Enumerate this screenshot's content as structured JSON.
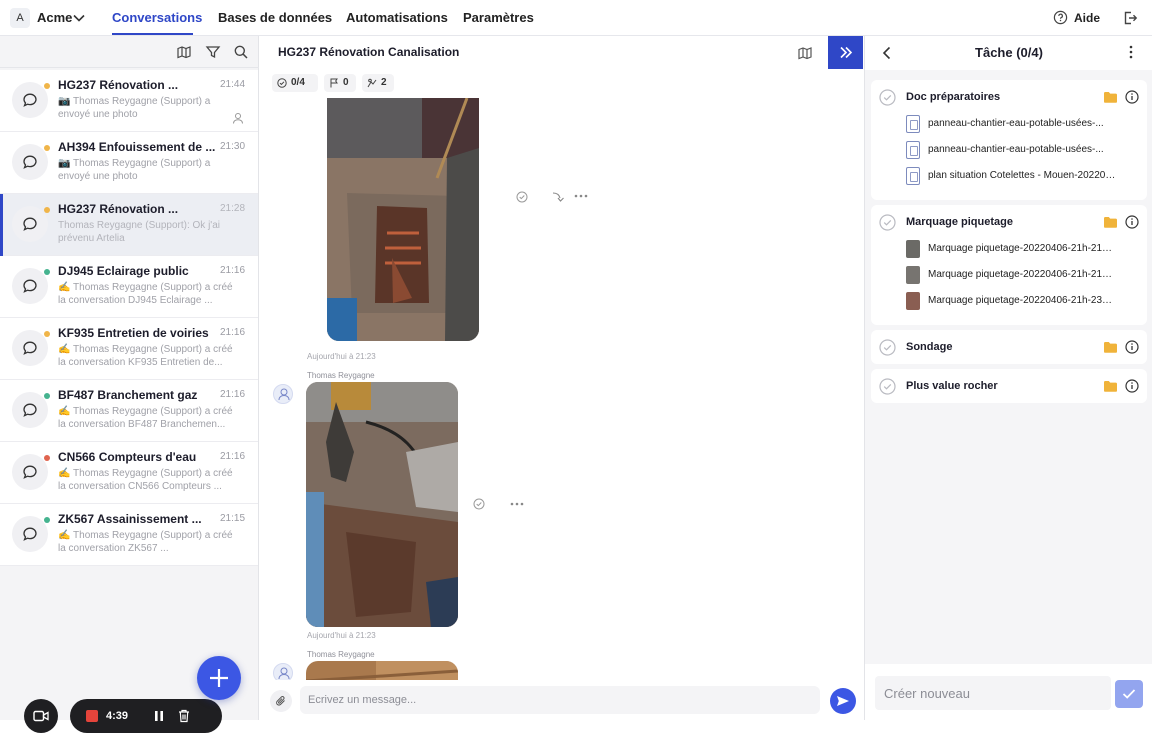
{
  "workspace": {
    "avatar_letter": "A",
    "name": "Acme"
  },
  "nav": {
    "items": [
      "Conversations",
      "Bases de données",
      "Automatisations",
      "Paramètres"
    ],
    "active": "Conversations",
    "help_label": "Aide"
  },
  "conversations": [
    {
      "title": "HG237 Rénovation ...",
      "time": "21:44",
      "preview": "📷 Thomas Reygagne (Support) a envoyé une photo",
      "dot": "#f0b549",
      "assigned_icon": true
    },
    {
      "title": "AH394 Enfouissement de ...",
      "time": "21:30",
      "preview": "📷 Thomas Reygagne (Support) a envoyé une photo",
      "dot": "#f0b549"
    },
    {
      "title": "HG237 Rénovation ...",
      "time": "21:28",
      "preview": "Thomas Reygagne (Support): Ok j'ai prévenu Artelia",
      "dot": "#f0b549",
      "selected": true
    },
    {
      "title": "DJ945 Eclairage public",
      "time": "21:16",
      "preview": "✍️ Thomas Reygagne (Support) a créé la conversation DJ945 Eclairage ...",
      "dot": "#45b38f"
    },
    {
      "title": "KF935 Entretien de voiries",
      "time": "21:16",
      "preview": "✍️ Thomas Reygagne (Support) a créé la conversation KF935 Entretien de...",
      "dot": "#f0b549"
    },
    {
      "title": "BF487 Branchement gaz",
      "time": "21:16",
      "preview": "✍️ Thomas Reygagne (Support) a créé la conversation BF487 Branchemen...",
      "dot": "#45b38f"
    },
    {
      "title": "CN566 Compteurs d'eau",
      "time": "21:16",
      "preview": "✍️ Thomas Reygagne (Support) a créé la conversation CN566 Compteurs ...",
      "dot": "#e0644f"
    },
    {
      "title": "ZK567 Assainissement ...",
      "time": "21:15",
      "preview": "✍️ Thomas Reygagne (Support) a créé la conversation ZK567 ...",
      "dot": "#45b38f"
    }
  ],
  "recording": {
    "time": "4:39"
  },
  "chat": {
    "title": "HG237 Rénovation Canalisation",
    "stats": {
      "tasks": "0/4",
      "flags": "0",
      "workers": "2"
    },
    "messages": [
      {
        "timestamp": "Aujourd'hui à 21:23"
      },
      {
        "sender": "Thomas Reygagne",
        "timestamp": "Aujourd'hui à 21:23"
      },
      {
        "sender": "Thomas Reygagne"
      }
    ],
    "composer_placeholder": "Ecrivez un message..."
  },
  "panel": {
    "title": "Tâche (0/4)",
    "tasks": [
      {
        "title": "Doc préparatoires",
        "files": [
          "panneau-chantier-eau-potable-usées-...",
          "panneau-chantier-eau-potable-usées-...",
          "plan situation Cotelettes - Mouen-2022040..."
        ]
      },
      {
        "title": "Marquage piquetage",
        "files": [
          "Marquage piquetage-20220406-21h-21m-...",
          "Marquage piquetage-20220406-21h-21m-...",
          "Marquage piquetage-20220406-21h-23m-..."
        ]
      },
      {
        "title": "Sondage",
        "files": []
      },
      {
        "title": "Plus value rocher",
        "files": []
      }
    ],
    "create_placeholder": "Créer nouveau"
  },
  "colors": {
    "accent": "#2f47c7",
    "fab": "#3c57e4",
    "folder": "#f0b33a",
    "record": "#e5443b"
  }
}
